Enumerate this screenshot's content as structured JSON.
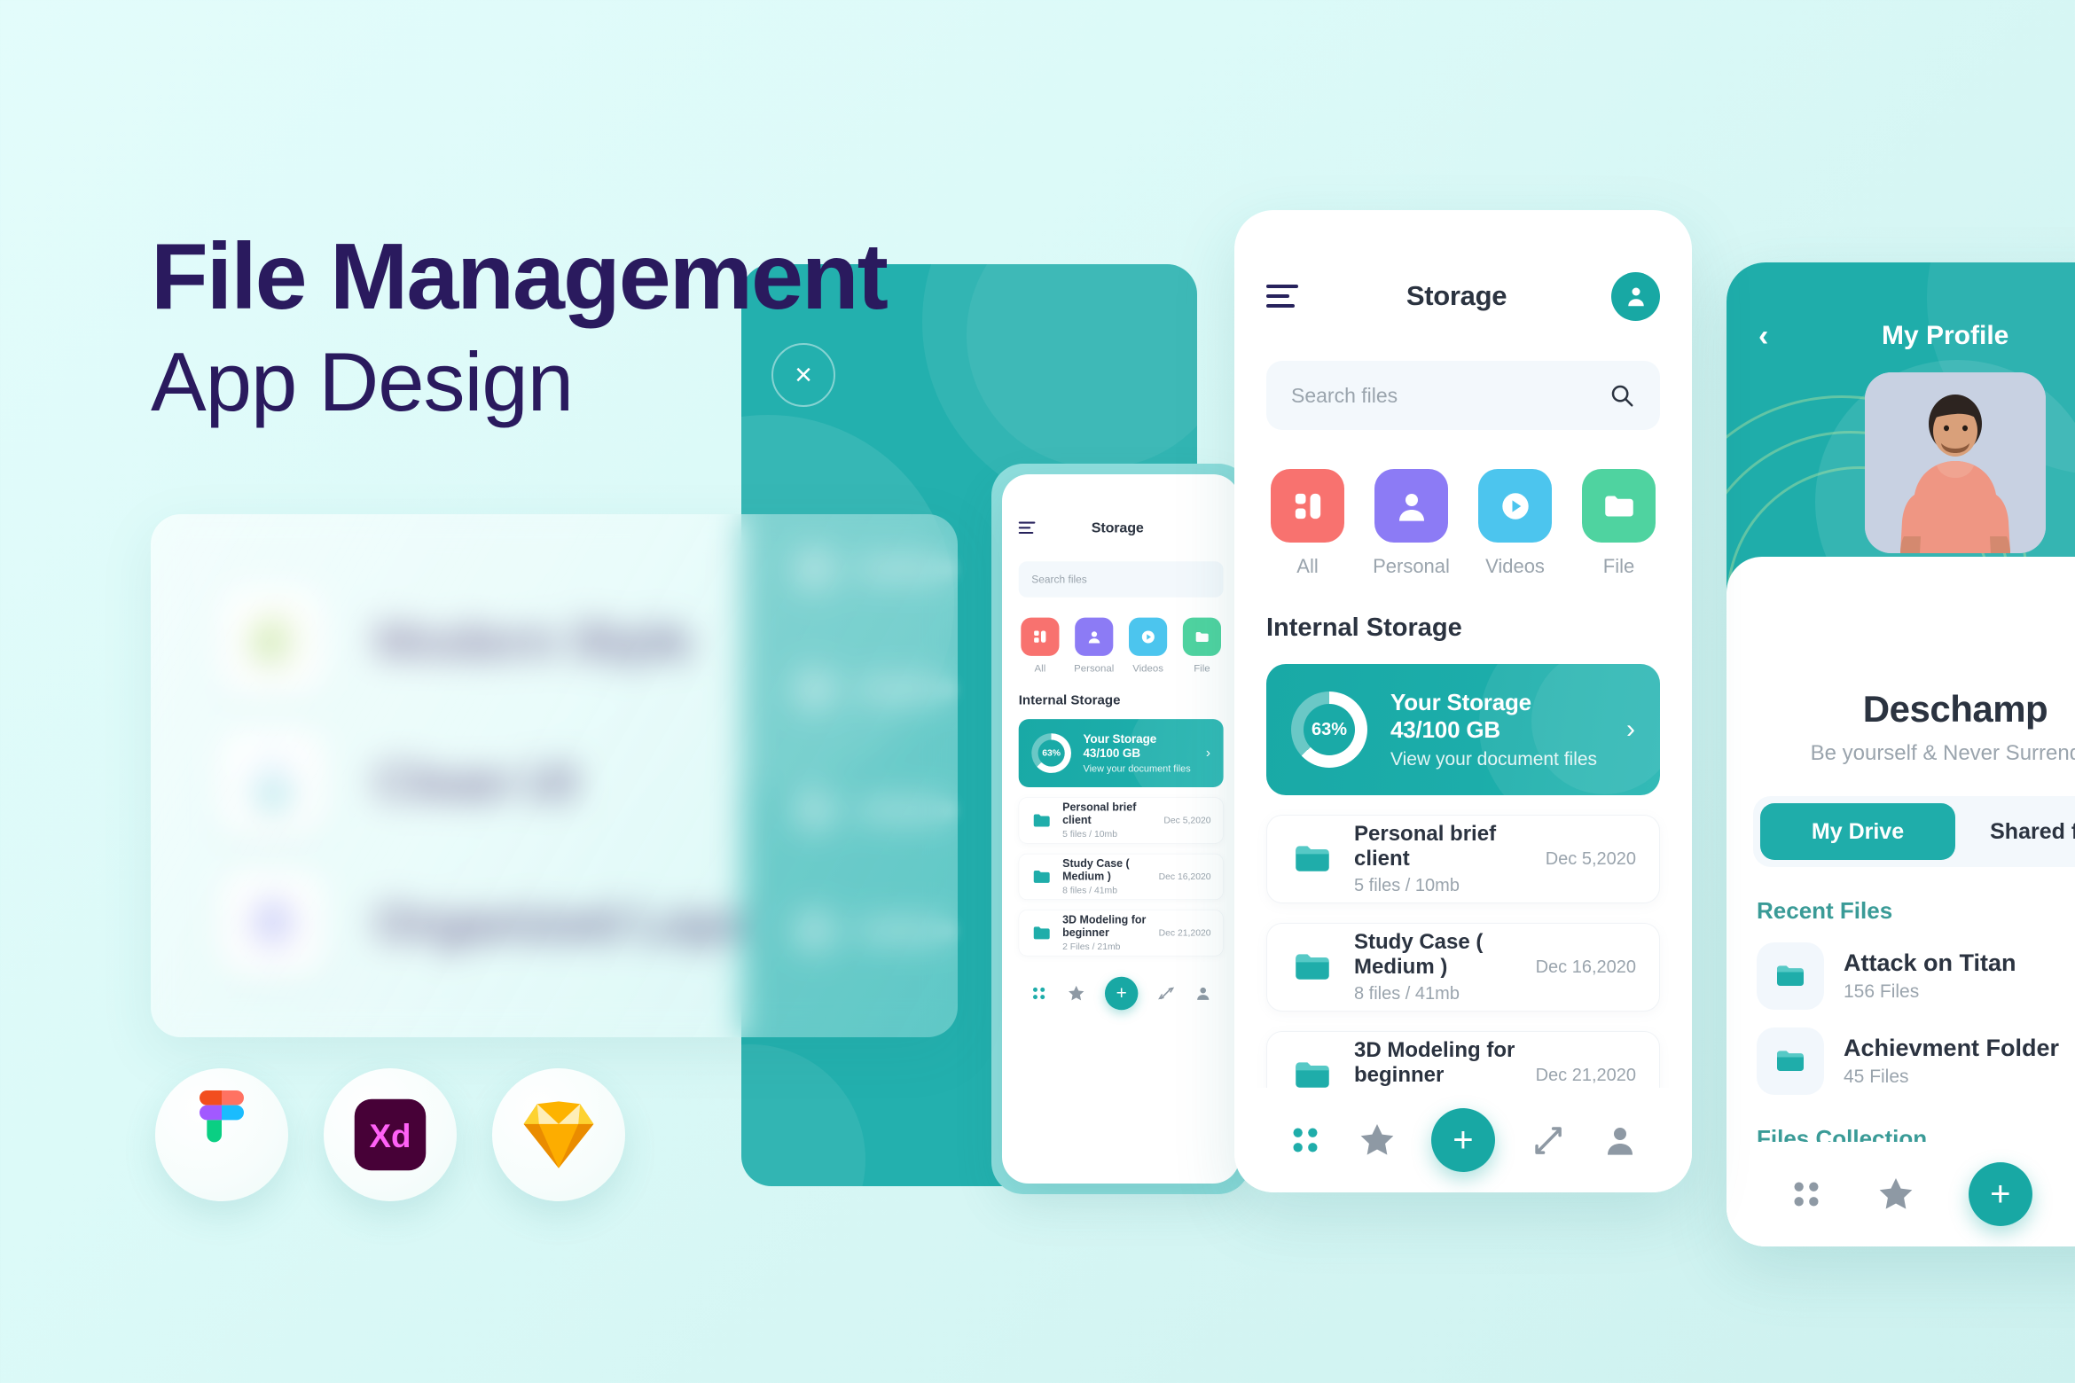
{
  "hero": {
    "title_line1": "File Management",
    "title_line2": "App Design"
  },
  "features": [
    {
      "label": "Modern Style",
      "icon": "phone-duplicate-icon",
      "color": "#8cc63f"
    },
    {
      "label": "Clean UI",
      "icon": "water-drop-icon",
      "color": "#2bb8c4"
    },
    {
      "label": "Organized Layers",
      "icon": "layers-icon",
      "color": "#6b74e8"
    }
  ],
  "tools": [
    {
      "name": "figma-logo",
      "label": "Figma"
    },
    {
      "name": "adobe-xd-logo",
      "label": "Xd"
    },
    {
      "name": "sketch-logo",
      "label": "Sketch"
    }
  ],
  "teal_panel": {
    "close_label": "×"
  },
  "storage_screen": {
    "menu_icon": "hamburger-menu-icon",
    "title": "Storage",
    "avatar_icon": "person-icon",
    "search": {
      "placeholder": "Search files",
      "icon": "search-icon"
    },
    "categories": [
      {
        "label": "All",
        "icon": "grid-icon",
        "color": "#f8726f"
      },
      {
        "label": "Personal",
        "icon": "person-icon",
        "color": "#8c7bf5"
      },
      {
        "label": "Videos",
        "icon": "play-icon",
        "color": "#4cc5ee"
      },
      {
        "label": "File",
        "icon": "folder-icon",
        "color": "#4fd3a0"
      }
    ],
    "section_title": "Internal Storage",
    "storage_card": {
      "percent_label": "63%",
      "percent_value": 63,
      "title": "Your Storage 43/100 GB",
      "subtitle": "View your document files",
      "arrow": "›"
    },
    "files": [
      {
        "name": "Personal brief client",
        "meta": "5 files / 10mb",
        "date": "Dec 5,2020"
      },
      {
        "name": "Study Case ( Medium )",
        "meta": "8 files / 41mb",
        "date": "Dec 16,2020"
      },
      {
        "name": "3D Modeling for beginner",
        "meta": "2 Files / 21mb",
        "date": "Dec 21,2020"
      }
    ],
    "tabbar": [
      {
        "name": "grid-icon"
      },
      {
        "name": "star-icon"
      },
      {
        "name": "add-icon",
        "label": "+"
      },
      {
        "name": "transfer-icon"
      },
      {
        "name": "person-icon"
      }
    ]
  },
  "profile_screen": {
    "back_icon": "chevron-left-icon",
    "title": "My Profile",
    "avatar_photo": "user-photo",
    "name": "Deschamp",
    "tagline": "Be yourself & Never Surrender",
    "tabs": [
      {
        "label": "My Drive",
        "active": true
      },
      {
        "label": "Shared files",
        "active": false
      }
    ],
    "recent_title": "Recent Files",
    "recent_files": [
      {
        "name": "Attack on Titan",
        "meta": "156 Files"
      },
      {
        "name": "Achievment Folder",
        "meta": "45 Files"
      }
    ],
    "collection_title": "Files Collection",
    "tabbar": [
      {
        "name": "grid-icon"
      },
      {
        "name": "star-icon"
      },
      {
        "name": "add-icon",
        "label": "+"
      },
      {
        "name": "transfer-icon"
      }
    ]
  },
  "colors": {
    "background": "#e0fbf9",
    "teal": "#23b0ae",
    "teal_dark": "#18a8a4",
    "navy": "#2a1a5e",
    "text_dark": "#2b3340",
    "text_muted": "#9aa4ad"
  }
}
